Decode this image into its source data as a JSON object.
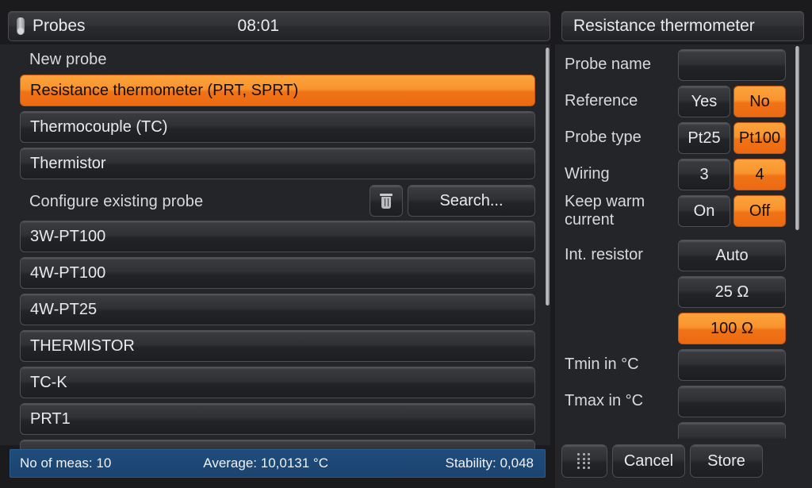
{
  "left": {
    "title": "Probes",
    "title_icon": "thermometer-icon",
    "clock": "08:01",
    "new_probe_label": "New probe",
    "new_probe_items": [
      {
        "label": "Resistance thermometer (PRT, SPRT)",
        "selected": true
      },
      {
        "label": "Thermocouple (TC)",
        "selected": false
      },
      {
        "label": "Thermistor",
        "selected": false
      }
    ],
    "configure_label": "Configure existing probe",
    "delete_icon": "trash-icon",
    "search_label": "Search...",
    "existing_probes": [
      "3W-PT100",
      "4W-PT100",
      "4W-PT25",
      "THERMISTOR",
      "TC-K",
      "PRT1"
    ]
  },
  "statusbar": {
    "no_of_meas": "No of meas: 10",
    "average": "Average: 10,0131 °C",
    "stability": "Stability: 0,048"
  },
  "right": {
    "title": "Resistance thermometer",
    "fields": [
      {
        "label": "Probe name",
        "type": "text",
        "value": ""
      },
      {
        "label": "Reference",
        "type": "toggle",
        "options": [
          {
            "label": "Yes",
            "selected": false
          },
          {
            "label": "No",
            "selected": true
          }
        ]
      },
      {
        "label": "Probe type",
        "type": "toggle",
        "options": [
          {
            "label": "Pt25",
            "selected": false
          },
          {
            "label": "Pt100",
            "selected": true
          }
        ]
      },
      {
        "label": "Wiring",
        "type": "toggle",
        "options": [
          {
            "label": "3",
            "selected": false
          },
          {
            "label": "4",
            "selected": true
          }
        ]
      },
      {
        "label": "Keep warm current",
        "type": "toggle",
        "options": [
          {
            "label": "On",
            "selected": false
          },
          {
            "label": "Off",
            "selected": true
          }
        ]
      },
      {
        "label": "Int. resistor",
        "type": "radio-stack",
        "options": [
          {
            "label": "Auto",
            "selected": false
          },
          {
            "label": "25 Ω",
            "selected": false
          },
          {
            "label": "100 Ω",
            "selected": true
          }
        ]
      },
      {
        "label": "Tmin in °C",
        "type": "text",
        "value": ""
      },
      {
        "label": "Tmax in °C",
        "type": "text",
        "value": ""
      }
    ]
  },
  "actions": {
    "keypad_icon": "keypad-icon",
    "cancel_label": "Cancel",
    "store_label": "Store"
  },
  "colors": {
    "accent_orange": "#F5963A",
    "accent_orange_dark": "#EC6A12",
    "panel_bg": "#242528",
    "status_blue": "#1F4C7C"
  }
}
